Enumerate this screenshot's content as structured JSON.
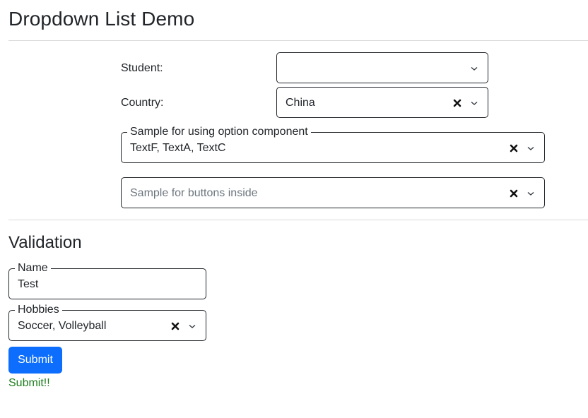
{
  "page": {
    "title": "Dropdown List Demo"
  },
  "form": {
    "student": {
      "label": "Student:",
      "value": ""
    },
    "country": {
      "label": "Country:",
      "value": "China"
    },
    "option_component": {
      "legend": "Sample for using option component",
      "value": "TextF, TextA, TextC"
    },
    "buttons_inside": {
      "placeholder": "Sample for buttons inside",
      "value": ""
    }
  },
  "validation": {
    "title": "Validation",
    "name": {
      "legend": "Name",
      "value": "Test"
    },
    "hobbies": {
      "legend": "Hobbies",
      "value": "Soccer, Volleyball"
    },
    "submit_label": "Submit",
    "submit_message": "Submit!!"
  },
  "icons": {
    "clear": "clear-icon",
    "chevron": "chevron-down-icon"
  },
  "colors": {
    "primary": "#0d6efd",
    "success_text": "#1e7b1e",
    "border": "#212529"
  }
}
